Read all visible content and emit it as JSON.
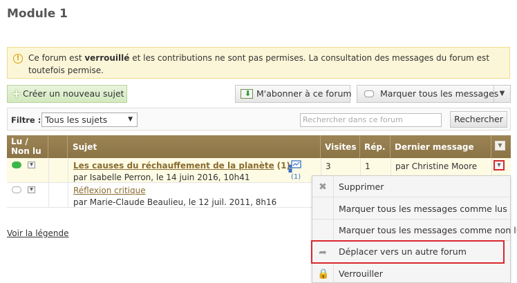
{
  "page": {
    "title": "Module 1"
  },
  "notice": {
    "text": "Ce forum est verrouillé et les contributions ne sont pas permises. La consultation des messages du forum est toutefois permise.",
    "part1": "Ce forum est ",
    "bold": "verrouillé",
    "part2": " et les contributions ne sont pas permises. La consultation des messages du forum est toutefois permise."
  },
  "toolbar": {
    "create_label": "Créer un nouveau sujet",
    "subscribe_label": "M'abonner à ce forum",
    "mark_label": "Marquer tous les messages"
  },
  "filter": {
    "label": "Filtre :",
    "selected": "Tous les sujets",
    "search_placeholder": "Rechercher dans ce forum",
    "search_button": "Rechercher"
  },
  "table": {
    "headers": {
      "read": "Lu / Non lu",
      "read_line1": "Lu /",
      "read_line2": "Non lu",
      "subject": "Sujet",
      "visits": "Visites",
      "replies": "Rép.",
      "last": "Dernier message"
    },
    "rows": [
      {
        "title": "Les causes du réchauffement de la planète",
        "count": "(1)",
        "by": "par Isabelle Perron, le 14 juin 2016, 10h41",
        "tag_count": "(1)",
        "visits": "3",
        "replies": "1",
        "last": "par Christine Moore",
        "unread": true
      },
      {
        "title": "Réflexion critique",
        "by": "par Marie-Claude Beaulieu, le 12 juil. 2011, 8h16",
        "unread": false
      }
    ]
  },
  "legend_link": "Voir la légende",
  "dropdown": {
    "items": [
      {
        "label": "Supprimer",
        "icon": "x-icon"
      },
      {
        "label": "Marquer tous les messages comme lus",
        "icon": ""
      },
      {
        "label": "Marquer tous les messages comme non lus",
        "icon": ""
      },
      {
        "label": "Déplacer vers un autre forum",
        "icon": "move-icon",
        "highlighted": true
      },
      {
        "label": "Verrouiller",
        "icon": "lock-icon"
      }
    ]
  },
  "colors": {
    "header": "#8f7849",
    "accent_red": "#d9262b",
    "notice_bg": "#fcf6d8",
    "link": "#8a6b2e"
  }
}
